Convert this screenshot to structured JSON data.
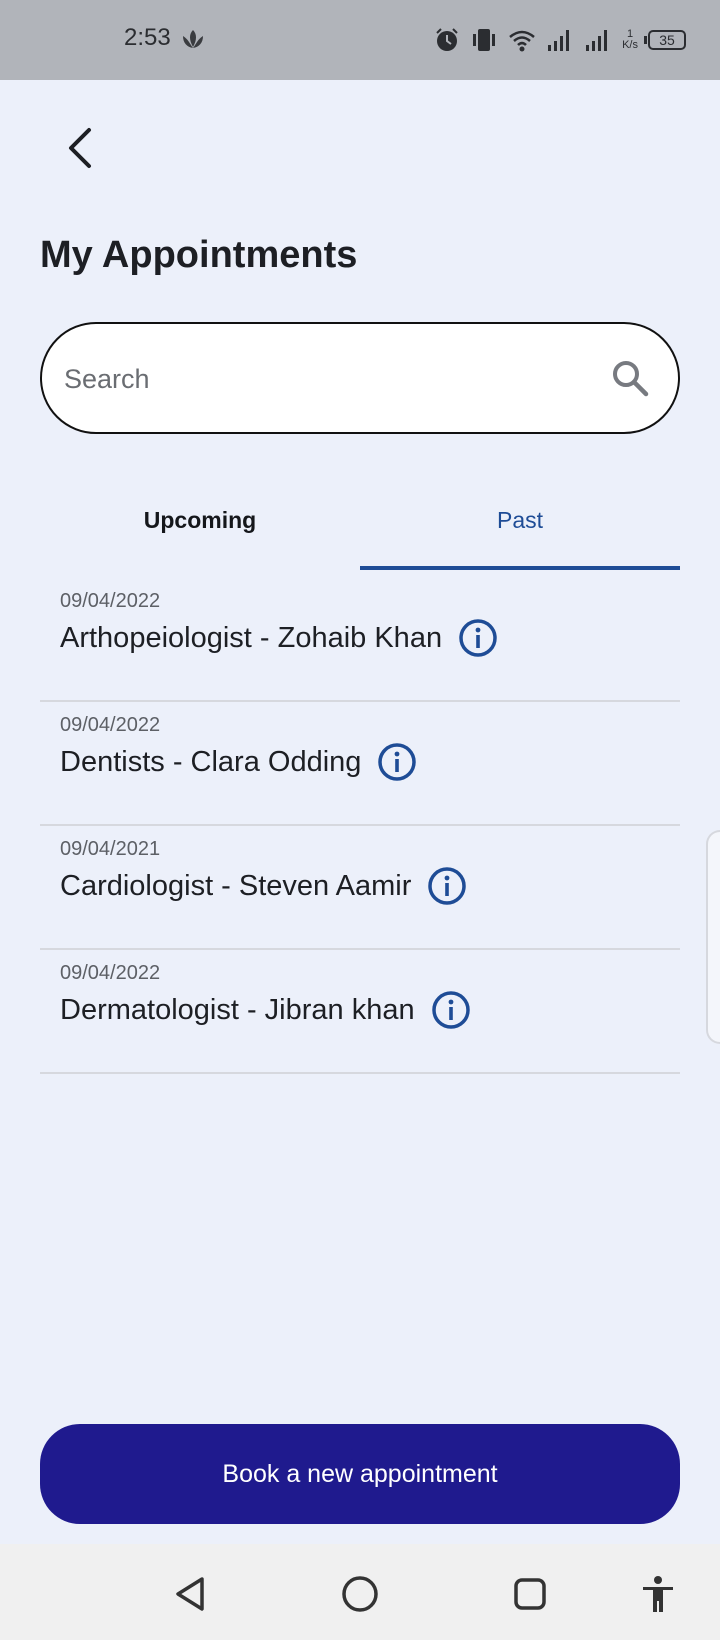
{
  "status_bar": {
    "time": "2:53",
    "network_speed_value": "1",
    "network_speed_unit": "K/s",
    "battery": "35"
  },
  "header": {
    "title": "My Appointments"
  },
  "search": {
    "placeholder": "Search",
    "value": ""
  },
  "tabs": [
    {
      "label": "Upcoming",
      "active": false
    },
    {
      "label": "Past",
      "active": true
    }
  ],
  "appointments": [
    {
      "date": "09/04/2022",
      "title": "Arthopeiologist - Zohaib Khan"
    },
    {
      "date": "09/04/2022",
      "title": "Dentists - Clara Odding"
    },
    {
      "date": "09/04/2021",
      "title": "Cardiologist - Steven Aamir"
    },
    {
      "date": "09/04/2022",
      "title": "Dermatologist - Jibran khan"
    }
  ],
  "actions": {
    "book_label": "Book a new appointment"
  },
  "colors": {
    "accent": "#1e4c96",
    "primary_button": "#1f1a8e",
    "background": "#ecf0fa"
  },
  "icons": [
    "leaf-icon",
    "alarm-icon",
    "vibrate-icon",
    "wifi-icon",
    "signal-icon",
    "battery-icon",
    "back-arrow-icon",
    "search-icon",
    "info-icon",
    "nav-back-icon",
    "nav-home-icon",
    "nav-recents-icon",
    "accessibility-icon"
  ]
}
